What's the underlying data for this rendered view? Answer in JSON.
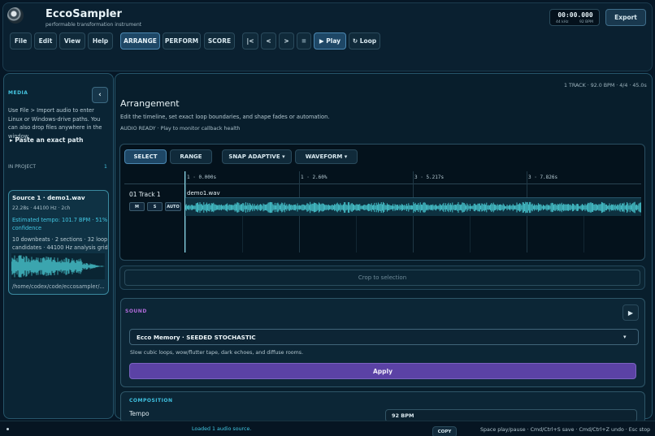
{
  "app": {
    "title": "EccoSampler",
    "subtitle": "performable transformation instrument"
  },
  "menu": [
    "File",
    "Edit",
    "View",
    "Help"
  ],
  "modes": [
    "ARRANGE",
    "PERFORM",
    "SCORE"
  ],
  "transport": {
    "to_start": "|<",
    "prev": "<",
    "next": ">",
    "stop": "■",
    "play": "▶ Play",
    "loop": "↻ Loop",
    "time": "00:00.000",
    "sample_rate": "44 kHz",
    "bpm": "92 BPM"
  },
  "export_label": "Export",
  "sidebar": {
    "section": "MEDIA",
    "collapse": "‹",
    "help": "Use File > Import audio to enter Linux or Windows-drive paths. You can also drop files anywhere in the window.",
    "paste": "▸  Paste an exact path",
    "in_project_label": "IN PROJECT",
    "in_project_count": "1",
    "source": {
      "name": "Source 1 · demo1.wav",
      "info": "22.28s · 44100 Hz · 2ch",
      "tempo": "Estimated tempo: 101.7 BPM · 51% confidence",
      "stats": "10 downbeats · 2 sections · 32 loop candidates · 44100 Hz analysis grid",
      "path": "/home/codex/code/eccosampler/..."
    }
  },
  "main": {
    "track_info": "1 TRACK · 92.0 BPM · 4/4 · 45.0s",
    "title": "Arrangement",
    "description": "Edit the timeline, set exact loop boundaries, and shape fades or automation.",
    "status": "AUDIO READY · Play to monitor callback health",
    "tools": {
      "select": "SELECT",
      "range": "RANGE",
      "snap": "SNAP ADAPTIVE  ▾",
      "view": "WAVEFORM     ▾"
    },
    "ruler_ticks": [
      "1 · 0.000s",
      "1 · 2.60%",
      "3 · 5.217s",
      "3 · 7.826s"
    ],
    "track": {
      "name": "01 Track 1",
      "mute": "M",
      "solo": "S",
      "auto": "AUTO",
      "clip": "demo1.wav"
    },
    "crop": "Crop to selection"
  },
  "sound": {
    "label": "SOUND",
    "play": "▶",
    "preset": "Ecco Memory · SEEDED STOCHASTIC",
    "caret": "▾",
    "description": "Slow cubic loops, wow/flutter tape, dark echoes, and diffuse rooms.",
    "apply": "Apply"
  },
  "composition": {
    "label": "COMPOSITION",
    "tempo_label": "Tempo",
    "tempo_value": "92 BPM"
  },
  "statusbar": {
    "message": "Loaded 1 audio source.",
    "copy": "COPY",
    "shortcuts": "Space play/pause · Cmd/Ctrl+S save · Cmd/Ctrl+Z undo · Esc stop"
  },
  "colors": {
    "accent": "#42c7e3",
    "sound": "#b06bd9",
    "apply": "#5b42a5",
    "waveform": "#48c6cf"
  }
}
